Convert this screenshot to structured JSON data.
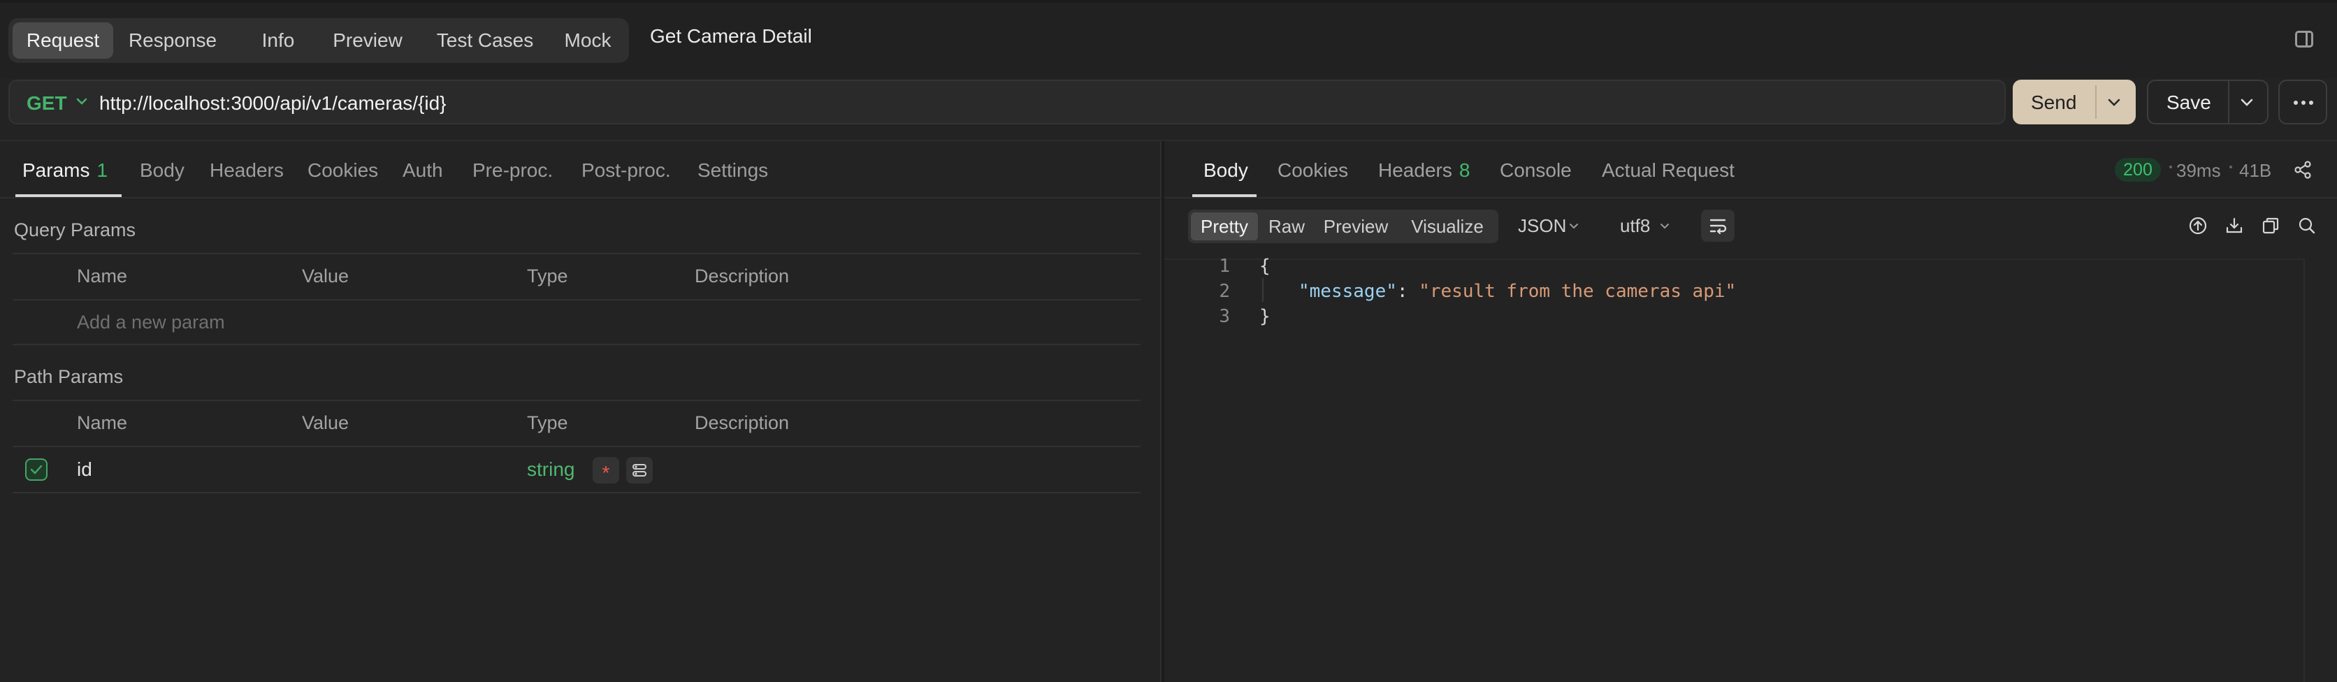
{
  "main_tabs": [
    {
      "label": "Request",
      "active": true
    },
    {
      "label": "Response",
      "active": false
    },
    {
      "label": "Info",
      "active": false
    },
    {
      "label": "Preview",
      "active": false
    },
    {
      "label": "Test Cases",
      "active": false
    },
    {
      "label": "Mock",
      "active": false
    }
  ],
  "page_title": "Get Camera Detail",
  "request": {
    "method": "GET",
    "url": "http://localhost:3000/api/v1/cameras/{id}",
    "send_label": "Send",
    "save_label": "Save"
  },
  "left_tabs": [
    {
      "label": "Params",
      "badge": "1",
      "active": true
    },
    {
      "label": "Body"
    },
    {
      "label": "Headers"
    },
    {
      "label": "Cookies"
    },
    {
      "label": "Auth"
    },
    {
      "label": "Pre-proc."
    },
    {
      "label": "Post-proc."
    },
    {
      "label": "Settings"
    }
  ],
  "query_params": {
    "title": "Query Params",
    "columns": [
      "Name",
      "Value",
      "Type",
      "Description"
    ],
    "placeholder": "Add a new param"
  },
  "path_params": {
    "title": "Path Params",
    "columns": [
      "Name",
      "Value",
      "Type",
      "Description"
    ],
    "rows": [
      {
        "name": "id",
        "value": "",
        "type": "string",
        "required_mark": "*",
        "checked": true
      }
    ]
  },
  "response_tabs": [
    {
      "label": "Body",
      "active": true
    },
    {
      "label": "Cookies"
    },
    {
      "label": "Headers",
      "badge": "8"
    },
    {
      "label": "Console"
    },
    {
      "label": "Actual Request"
    }
  ],
  "response_meta": {
    "status": "200",
    "time": "39ms",
    "size": "41B"
  },
  "view_modes": [
    {
      "label": "Pretty",
      "active": true
    },
    {
      "label": "Raw"
    },
    {
      "label": "Preview"
    },
    {
      "label": "Visualize"
    }
  ],
  "format_select": "JSON",
  "encoding_select": "utf8",
  "code": {
    "line_numbers": [
      "1",
      "2",
      "3"
    ],
    "open_brace": "{",
    "key": "\"message\"",
    "colon": ": ",
    "value": "\"result from the cameras api\"",
    "close_brace": "}"
  },
  "icons": {
    "panel_toggle": "sidebar-toggle-icon",
    "more": "more-horizontal-icon",
    "share": "share-icon",
    "wrap": "word-wrap-icon",
    "upload": "upload-icon",
    "download": "download-icon",
    "copy": "copy-icon",
    "search": "search-icon"
  },
  "colors": {
    "method_get": "#45b36b",
    "send_button": "#d8c9b2",
    "status_ok": "#3fc06d",
    "type_string": "#4fb870",
    "required": "#e85b4b"
  }
}
